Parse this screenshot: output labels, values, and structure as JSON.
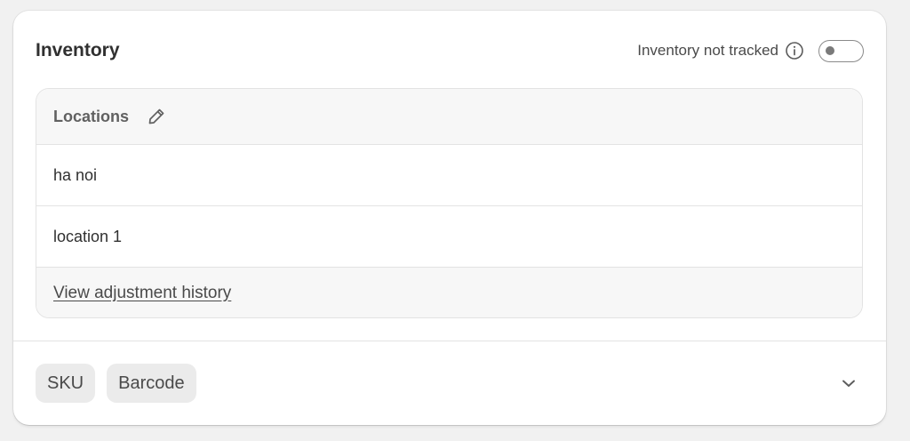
{
  "inventory": {
    "title": "Inventory",
    "tracking_label": "Inventory not tracked",
    "tracking_enabled": false
  },
  "locations": {
    "header_label": "Locations",
    "items": [
      {
        "name": "ha noi"
      },
      {
        "name": "location 1"
      }
    ],
    "history_link": "View adjustment history"
  },
  "identifiers": {
    "sku_label": "SKU",
    "barcode_label": "Barcode"
  },
  "icons": {
    "info": "info-icon",
    "edit": "pencil-icon",
    "expand": "chevron-down-icon"
  }
}
